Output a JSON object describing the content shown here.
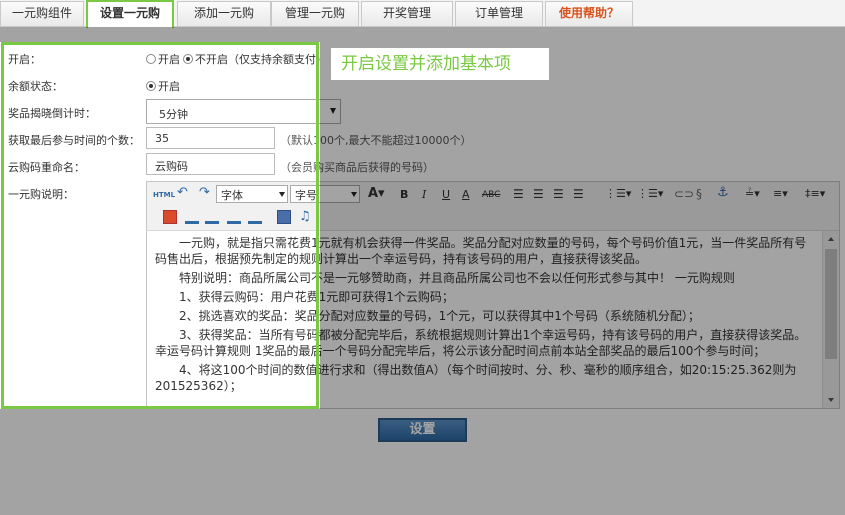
{
  "tabs": [
    {
      "label": "一元购组件"
    },
    {
      "label": "设置一元购"
    },
    {
      "label": "添加一元购"
    },
    {
      "label": "管理一元购"
    },
    {
      "label": "开奖管理"
    },
    {
      "label": "订单管理"
    },
    {
      "label": "使用帮助？"
    }
  ],
  "form": {
    "enable_label": "开启：",
    "enable_on": "开启",
    "enable_off": "不开启（仅支持余额支付）",
    "balance_label": "余额状态：",
    "balance_on": "开启",
    "countdown_label": "奖品揭晓倒计时：",
    "countdown_value": "5分钟",
    "count_label": "获取最后参与时间的个数：",
    "count_value": "35",
    "count_hint": "（默认100个,最大不能超过10000个）",
    "rename_label": "云购码重命名：",
    "rename_value": "云购码",
    "rename_hint": "（会员购买商品后获得的号码）",
    "desc_label": "一元购说明："
  },
  "toolbar": {
    "font_label": "字体",
    "size_label": "字号"
  },
  "content": [
    "一元购，就是指只需花费1元就有机会获得一件奖品。奖品分配对应数量的号码，每个号码价值1元，当一件奖品所有号码售出后，根据预先制定的规则计算出一个幸运号码，持有该号码的用户，直接获得该奖品。",
    "特别说明：商品所属公司不是一元够赞助商，并且商品所属公司也不会以任何形式参与其中！ 一元购规则",
    "1、获得云购码：用户花费1元即可获得1个云购码；",
    "2、挑选喜欢的奖品：奖品分配对应数量的号码，1个元，可以获得其中1个号码（系统随机分配）；",
    "3、获得奖品：当所有号码都被分配完毕后，系统根据规则计算出1个幸运号码，持有该号码的用户，直接获得该奖品。 幸运号码计算规则 1奖品的最后一个号码分配完毕后，将公示该分配时间点前本站全部奖品的最后100个参与时间；",
    "4、将这100个时间的数值进行求和（得出数值A）（每个时间按时、分、秒、毫秒的顺序组合，如20:15:25.362则为201525362）；"
  ],
  "callout": "开启设置并添加基本项",
  "submit_label": "设置",
  "colors": {
    "highlight": "#7ac943",
    "submit_bg": "#2f6aa6",
    "help_tab": "#d9541e"
  }
}
